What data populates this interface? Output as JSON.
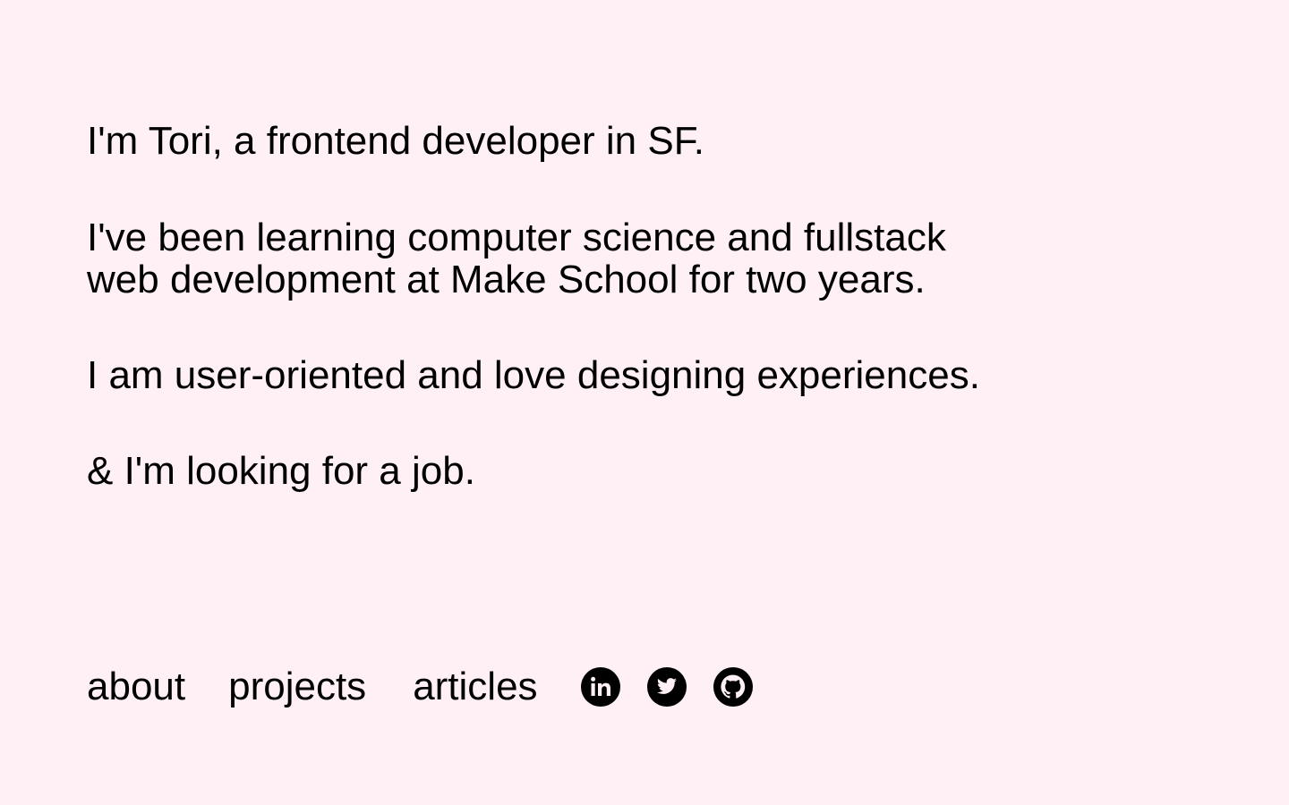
{
  "intro": {
    "line1": "I'm Tori, a frontend developer in SF.",
    "line2": "I've been learning computer science and fullstack web development at Make School for two years.",
    "line3": "I am user-oriented and love designing experiences.",
    "line4": "& I'm looking for a job."
  },
  "nav": {
    "about": "about",
    "projects": "projects",
    "articles": "articles"
  },
  "social": {
    "icons": [
      "linkedin-icon",
      "twitter-icon",
      "github-icon"
    ]
  },
  "colors": {
    "background": "#fff0f5",
    "text": "#000000"
  }
}
